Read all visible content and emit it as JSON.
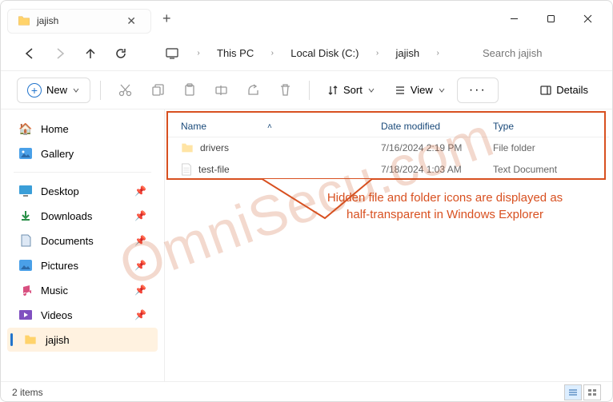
{
  "tab": {
    "title": "jajish"
  },
  "breadcrumbs": {
    "b0": "This PC",
    "b1": "Local Disk (C:)",
    "b2": "jajish"
  },
  "search": {
    "placeholder": "Search jajish"
  },
  "toolbar": {
    "new": "New",
    "sort": "Sort",
    "view": "View",
    "details": "Details"
  },
  "columns": {
    "name": "Name",
    "date": "Date modified",
    "type": "Type"
  },
  "sidebar": {
    "home": "Home",
    "gallery": "Gallery",
    "desktop": "Desktop",
    "downloads": "Downloads",
    "documents": "Documents",
    "pictures": "Pictures",
    "music": "Music",
    "videos": "Videos",
    "jajish": "jajish"
  },
  "files": {
    "f0": {
      "name": "drivers",
      "date": "7/16/2024 2:19 PM",
      "type": "File folder"
    },
    "f1": {
      "name": "test-file",
      "date": "7/18/2024 1:03 AM",
      "type": "Text Document"
    }
  },
  "status": {
    "text": "2 items"
  },
  "annotation": {
    "text": "Hidden file and folder icons are displayed as half-transparent in Windows Explorer"
  },
  "watermark": {
    "text": "OmniSecu.com"
  }
}
